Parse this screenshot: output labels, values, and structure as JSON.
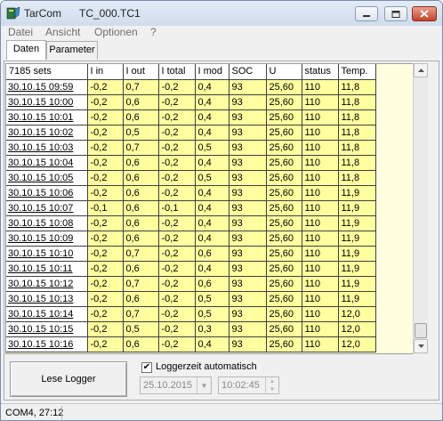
{
  "window": {
    "app_name": "TarCom",
    "document_name": "TC_000.TC1"
  },
  "menu": [
    "Datei",
    "Ansicht",
    "Optionen",
    "?"
  ],
  "tabs": [
    {
      "label": "Daten",
      "active": true
    },
    {
      "label": "Parameter",
      "active": false
    }
  ],
  "table": {
    "corner_label": "7185 sets",
    "columns": [
      "I in",
      "I out",
      "I total",
      "I mod",
      "SOC",
      "U",
      "status",
      "Temp."
    ],
    "rows": [
      {
        "time": "30.10.15 09:59",
        "values": [
          "-0,2",
          "0,7",
          "-0,2",
          "0,4",
          "93",
          "25,60",
          "110",
          "11,8"
        ]
      },
      {
        "time": "30.10.15 10:00",
        "values": [
          "-0,2",
          "0,6",
          "-0,2",
          "0,4",
          "93",
          "25,60",
          "110",
          "11,8"
        ]
      },
      {
        "time": "30.10.15 10:01",
        "values": [
          "-0,2",
          "0,6",
          "-0,2",
          "0,4",
          "93",
          "25,60",
          "110",
          "11,8"
        ]
      },
      {
        "time": "30.10.15 10:02",
        "values": [
          "-0,2",
          "0,5",
          "-0,2",
          "0,4",
          "93",
          "25,60",
          "110",
          "11,8"
        ]
      },
      {
        "time": "30.10.15 10:03",
        "values": [
          "-0,2",
          "0,7",
          "-0,2",
          "0,5",
          "93",
          "25,60",
          "110",
          "11,8"
        ]
      },
      {
        "time": "30.10.15 10:04",
        "values": [
          "-0,2",
          "0,6",
          "-0,2",
          "0,4",
          "93",
          "25,60",
          "110",
          "11,8"
        ]
      },
      {
        "time": "30.10.15 10:05",
        "values": [
          "-0,2",
          "0,6",
          "-0,2",
          "0,5",
          "93",
          "25,60",
          "110",
          "11,8"
        ]
      },
      {
        "time": "30.10.15 10:06",
        "values": [
          "-0,2",
          "0,6",
          "-0,2",
          "0,4",
          "93",
          "25,60",
          "110",
          "11,9"
        ]
      },
      {
        "time": "30.10.15 10:07",
        "values": [
          "-0,1",
          "0,6",
          "-0,1",
          "0,4",
          "93",
          "25,60",
          "110",
          "11,9"
        ]
      },
      {
        "time": "30.10.15 10:08",
        "values": [
          "-0,2",
          "0,6",
          "-0,2",
          "0,4",
          "93",
          "25,60",
          "110",
          "11,9"
        ]
      },
      {
        "time": "30.10.15 10:09",
        "values": [
          "-0,2",
          "0,6",
          "-0,2",
          "0,4",
          "93",
          "25,60",
          "110",
          "11,9"
        ]
      },
      {
        "time": "30.10.15 10:10",
        "values": [
          "-0,2",
          "0,7",
          "-0,2",
          "0,6",
          "93",
          "25,60",
          "110",
          "11,9"
        ]
      },
      {
        "time": "30.10.15 10:11",
        "values": [
          "-0,2",
          "0,6",
          "-0,2",
          "0,4",
          "93",
          "25,60",
          "110",
          "11,9"
        ]
      },
      {
        "time": "30.10.15 10:12",
        "values": [
          "-0,2",
          "0,7",
          "-0,2",
          "0,6",
          "93",
          "25,60",
          "110",
          "11,9"
        ]
      },
      {
        "time": "30.10.15 10:13",
        "values": [
          "-0,2",
          "0,6",
          "-0,2",
          "0,5",
          "93",
          "25,60",
          "110",
          "11,9"
        ]
      },
      {
        "time": "30.10.15 10:14",
        "values": [
          "-0,2",
          "0,7",
          "-0,2",
          "0,5",
          "93",
          "25,60",
          "110",
          "12,0"
        ]
      },
      {
        "time": "30.10.15 10:15",
        "values": [
          "-0,2",
          "0,5",
          "-0,2",
          "0,3",
          "93",
          "25,60",
          "110",
          "12,0"
        ]
      },
      {
        "time": "30.10.15 10:16",
        "values": [
          "-0,2",
          "0,6",
          "-0,2",
          "0,4",
          "93",
          "25,60",
          "110",
          "12,0"
        ]
      }
    ]
  },
  "controls": {
    "read_button": "Lese Logger",
    "auto_time_label": "Loggerzeit automatisch",
    "auto_time_checked": true,
    "date_value": "25.10.2015",
    "time_value": "10:02:45"
  },
  "status": {
    "text": "COM4, 27:12"
  },
  "colors": {
    "grid_cell": "#ffffa0",
    "grid_background": "#ffffe0"
  }
}
